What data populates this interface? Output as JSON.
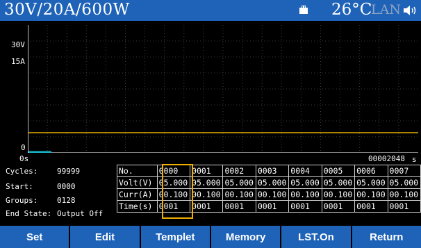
{
  "status": {
    "model": "30V/20A/600W",
    "temperature": "26°C",
    "lan": "LAN",
    "usb_icon": "usb-storage-icon",
    "speaker_icon": "speaker-icon"
  },
  "plot": {
    "y_labels": [
      "30V",
      "15A",
      "0"
    ],
    "x_start": "0s",
    "x_end": "00002048",
    "x_unit": "s",
    "colors": {
      "grid": "#3c3c3c",
      "axis": "#ffffff",
      "trace_main": "#e6b100",
      "trace_cyan": "#19b5c8"
    }
  },
  "info": {
    "cycles_label": "Cycles:",
    "cycles_value": "99999",
    "start_label": "Start:",
    "start_value": "0000",
    "groups_label": "Groups:",
    "groups_value": "0128",
    "endstate_label": "End State:",
    "endstate_value": "Output Off"
  },
  "list_table": {
    "headers": [
      "No.",
      "Volt(V)",
      "Curr(A)",
      "Time(s)"
    ],
    "rows": [
      [
        "0000",
        "0001",
        "0002",
        "0003",
        "0004",
        "0005",
        "0006",
        "0007"
      ],
      [
        "05.000",
        "05.000",
        "05.000",
        "05.000",
        "05.000",
        "05.000",
        "05.000",
        "05.000"
      ],
      [
        "00.100",
        "00.100",
        "00.100",
        "00.100",
        "00.100",
        "00.100",
        "00.100",
        "00.100"
      ],
      [
        "0001",
        "0001",
        "0001",
        "0001",
        "0001",
        "0001",
        "0001",
        "0001"
      ]
    ]
  },
  "softkeys": [
    "Set",
    "Edit",
    "Templet",
    "Memory",
    "LST.On",
    "Return"
  ]
}
